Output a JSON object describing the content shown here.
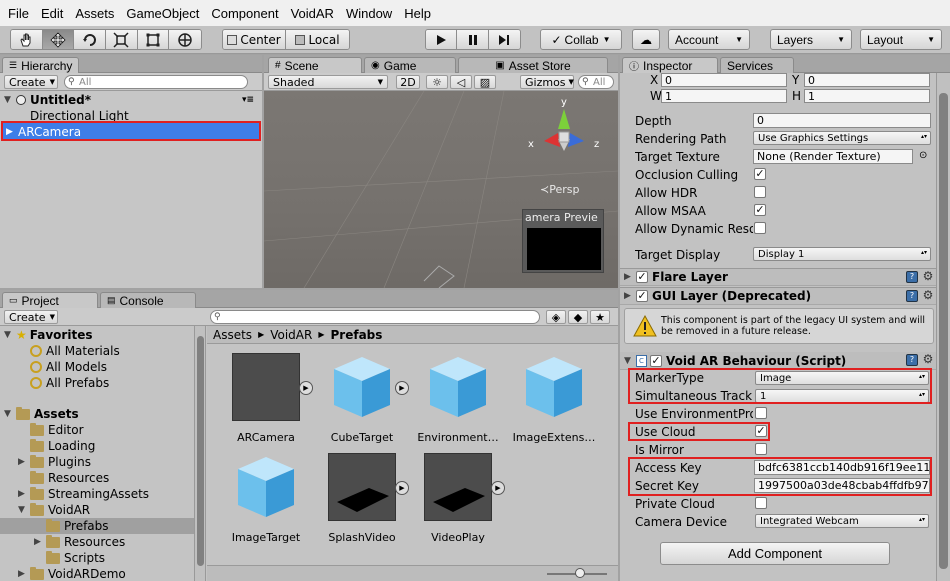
{
  "menu": [
    "File",
    "Edit",
    "Assets",
    "GameObject",
    "Component",
    "VoidAR",
    "Window",
    "Help"
  ],
  "toolbar": {
    "tools": [
      "hand-icon",
      "move-icon",
      "rotate-icon",
      "scale-icon",
      "rect-icon",
      "transform-icon"
    ],
    "pivot": "Center",
    "space": "Local",
    "collab": "Collab",
    "account": "Account",
    "layers": "Layers",
    "layout": "Layout"
  },
  "hierarchy": {
    "tab": "Hierarchy",
    "create": "Create",
    "search_placeholder": "All",
    "scene": "Untitled*",
    "items": [
      "Directional Light",
      "ARCamera"
    ]
  },
  "scene": {
    "tabs": [
      "Scene",
      "Game",
      "Asset Store"
    ],
    "shading": "Shaded",
    "mode2d": "2D",
    "gizmos": "Gizmos",
    "search_placeholder": "All",
    "persp": "Persp",
    "axis_y": "y",
    "axis_x": "x",
    "axis_z": "z",
    "camera_preview": "amera Previe"
  },
  "project": {
    "tabs": [
      "Project",
      "Console"
    ],
    "create": "Create",
    "favorites_label": "Favorites",
    "favorites": [
      "All Materials",
      "All Models",
      "All Prefabs"
    ],
    "assets_label": "Assets",
    "folders": [
      "Editor",
      "Loading",
      "Plugins",
      "Resources",
      "StreamingAssets",
      "VoidAR",
      "Prefabs",
      "Resources",
      "Scripts",
      "VoidARDemo"
    ],
    "breadcrumb": [
      "Assets",
      "VoidAR",
      "Prefabs"
    ],
    "assets": [
      "ARCamera",
      "CubeTarget",
      "Environment…",
      "ImageExtens…",
      "ImageTarget",
      "SplashVideo",
      "VideoPlay"
    ]
  },
  "inspector": {
    "tabs": [
      "Inspector",
      "Services"
    ],
    "rect": {
      "x_label": "X",
      "x": "0",
      "y_label": "Y",
      "y": "0",
      "w_label": "W",
      "w": "1",
      "h_label": "H",
      "h": "1"
    },
    "camera": {
      "depth_label": "Depth",
      "depth": "0",
      "rendering_path_label": "Rendering Path",
      "rendering_path": "Use Graphics Settings",
      "target_texture_label": "Target Texture",
      "target_texture": "None (Render Texture)",
      "occlusion_label": "Occlusion Culling",
      "hdr_label": "Allow HDR",
      "msaa_label": "Allow MSAA",
      "dynres_label": "Allow Dynamic Reso",
      "target_display_label": "Target Display",
      "target_display": "Display 1"
    },
    "flare_layer": "Flare Layer",
    "gui_layer": "GUI Layer (Deprecated)",
    "gui_warning": "This component is part of the legacy UI system and will be removed in a future release.",
    "voidar": {
      "title": "Void AR Behaviour (Script)",
      "marker_type_label": "MarkerType",
      "marker_type": "Image",
      "simultaneous_label": "Simultaneous Tracki",
      "simultaneous": "1",
      "use_env_label": "Use EnvironmentPro",
      "use_cloud_label": "Use Cloud",
      "is_mirror_label": "Is Mirror",
      "access_key_label": "Access Key",
      "access_key": "bdfc6381ccb140db916f19ee11",
      "secret_key_label": "Secret Key",
      "secret_key": "1997500a03de48cbab4ffdfb97",
      "private_cloud_label": "Private Cloud",
      "camera_device_label": "Camera Device",
      "camera_device": "Integrated Webcam"
    },
    "add_component": "Add Component"
  }
}
